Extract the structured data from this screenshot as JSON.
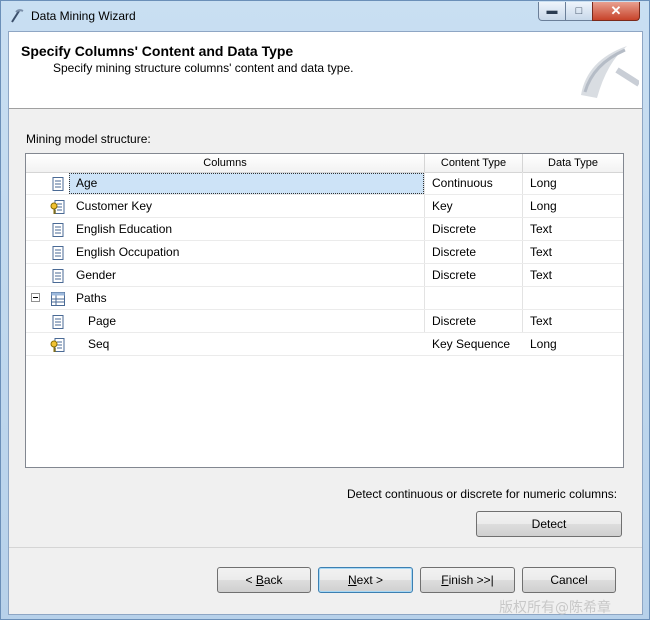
{
  "window": {
    "title": "Data Mining Wizard",
    "controls": [
      "minimize",
      "maximize",
      "close"
    ]
  },
  "header": {
    "title": "Specify Columns' Content and Data Type",
    "subtitle": "Specify mining structure columns' content and data type."
  },
  "structure": {
    "label": "Mining model structure:",
    "columns": [
      "Columns",
      "Content Type",
      "Data Type"
    ],
    "rows": [
      {
        "name": "Age",
        "content_type": "Continuous",
        "data_type": "Long",
        "icon": "column-icon",
        "indent": 0,
        "selected": true
      },
      {
        "name": "Customer Key",
        "content_type": "Key",
        "data_type": "Long",
        "icon": "key-column-icon",
        "indent": 0,
        "selected": false
      },
      {
        "name": "English Education",
        "content_type": "Discrete",
        "data_type": "Text",
        "icon": "column-icon",
        "indent": 0,
        "selected": false
      },
      {
        "name": "English Occupation",
        "content_type": "Discrete",
        "data_type": "Text",
        "icon": "column-icon",
        "indent": 0,
        "selected": false
      },
      {
        "name": "Gender",
        "content_type": "Discrete",
        "data_type": "Text",
        "icon": "column-icon",
        "indent": 0,
        "selected": false
      },
      {
        "name": "Paths",
        "content_type": "",
        "data_type": "",
        "icon": "nested-table-icon",
        "indent": 0,
        "expanded": true,
        "selected": false
      },
      {
        "name": "Page",
        "content_type": "Discrete",
        "data_type": "Text",
        "icon": "column-icon",
        "indent": 1,
        "selected": false
      },
      {
        "name": "Seq",
        "content_type": "Key Sequence",
        "data_type": "Long",
        "icon": "key-column-icon",
        "indent": 1,
        "selected": false
      }
    ]
  },
  "detect": {
    "label": "Detect continuous or discrete for numeric columns:",
    "button": "Detect"
  },
  "footer": {
    "back": "< Back",
    "next": "Next >",
    "finish": "Finish >>|",
    "cancel": "Cancel"
  },
  "watermark": "版权所有@陈希章"
}
